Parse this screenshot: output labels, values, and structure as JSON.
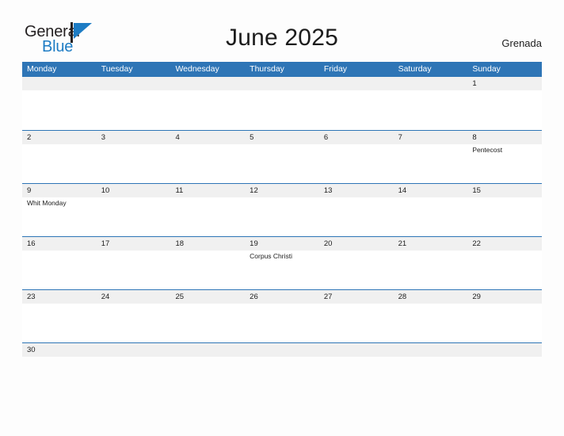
{
  "brand": {
    "name_part1": "General",
    "name_part2": "Blue",
    "flag_icon": "flag-triangle-icon",
    "color_dark": "#231f20",
    "color_blue": "#1d7cc4"
  },
  "header": {
    "title": "June 2025",
    "country": "Grenada",
    "accent_color": "#2e75b6",
    "band_color": "#f0f0f0"
  },
  "weekdays": [
    "Monday",
    "Tuesday",
    "Wednesday",
    "Thursday",
    "Friday",
    "Saturday",
    "Sunday"
  ],
  "weeks": [
    {
      "size": "tall",
      "days": [
        {
          "number": "",
          "event": ""
        },
        {
          "number": "",
          "event": ""
        },
        {
          "number": "",
          "event": ""
        },
        {
          "number": "",
          "event": ""
        },
        {
          "number": "",
          "event": ""
        },
        {
          "number": "",
          "event": ""
        },
        {
          "number": "1",
          "event": ""
        }
      ]
    },
    {
      "size": "tall",
      "days": [
        {
          "number": "2",
          "event": ""
        },
        {
          "number": "3",
          "event": ""
        },
        {
          "number": "4",
          "event": ""
        },
        {
          "number": "5",
          "event": ""
        },
        {
          "number": "6",
          "event": ""
        },
        {
          "number": "7",
          "event": ""
        },
        {
          "number": "8",
          "event": "Pentecost"
        }
      ]
    },
    {
      "size": "tall",
      "days": [
        {
          "number": "9",
          "event": "Whit Monday"
        },
        {
          "number": "10",
          "event": ""
        },
        {
          "number": "11",
          "event": ""
        },
        {
          "number": "12",
          "event": ""
        },
        {
          "number": "13",
          "event": ""
        },
        {
          "number": "14",
          "event": ""
        },
        {
          "number": "15",
          "event": ""
        }
      ]
    },
    {
      "size": "tall",
      "days": [
        {
          "number": "16",
          "event": ""
        },
        {
          "number": "17",
          "event": ""
        },
        {
          "number": "18",
          "event": ""
        },
        {
          "number": "19",
          "event": "Corpus Christi"
        },
        {
          "number": "20",
          "event": ""
        },
        {
          "number": "21",
          "event": ""
        },
        {
          "number": "22",
          "event": ""
        }
      ]
    },
    {
      "size": "tall",
      "days": [
        {
          "number": "23",
          "event": ""
        },
        {
          "number": "24",
          "event": ""
        },
        {
          "number": "25",
          "event": ""
        },
        {
          "number": "26",
          "event": ""
        },
        {
          "number": "27",
          "event": ""
        },
        {
          "number": "28",
          "event": ""
        },
        {
          "number": "29",
          "event": ""
        }
      ]
    },
    {
      "size": "short",
      "days": [
        {
          "number": "30",
          "event": ""
        },
        {
          "number": "",
          "event": ""
        },
        {
          "number": "",
          "event": ""
        },
        {
          "number": "",
          "event": ""
        },
        {
          "number": "",
          "event": ""
        },
        {
          "number": "",
          "event": ""
        },
        {
          "number": "",
          "event": ""
        }
      ]
    }
  ]
}
